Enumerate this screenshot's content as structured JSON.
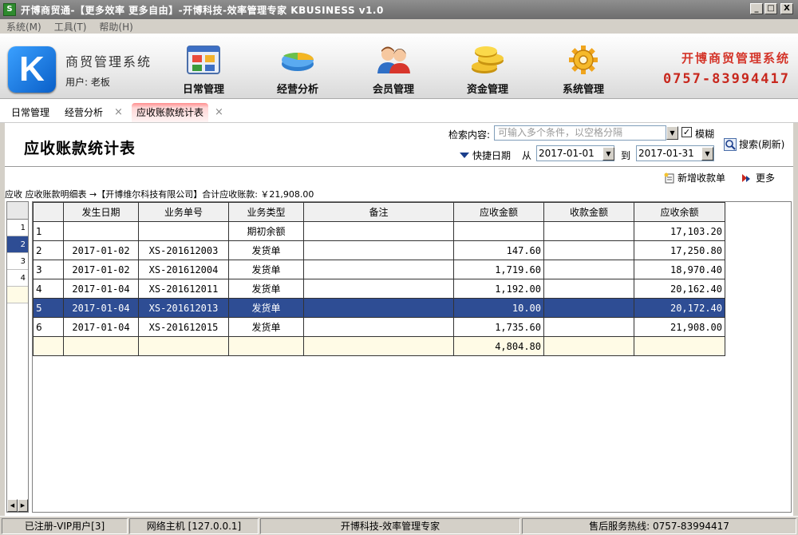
{
  "window": {
    "title": "开博商贸通-【更多效率 更多自由】-开博科技-效率管理专家  KBUSINESS v1.0",
    "icon_letter": "S",
    "btn_min": "_",
    "btn_max": "□",
    "btn_close": "X"
  },
  "menu": [
    "系统(M)",
    "工具(T)",
    "帮助(H)"
  ],
  "header": {
    "logo_letter": "K",
    "system_name": "商贸管理系统",
    "user": "用户: 老板",
    "nav": [
      "日常管理",
      "经营分析",
      "会员管理",
      "资金管理",
      "系统管理"
    ],
    "brand_name": "开博商贸管理系统",
    "brand_phone": "0757-83994417"
  },
  "tabs": {
    "tab1": "日常管理",
    "tab2": "经营分析",
    "tab3": "应收账款统计表",
    "close_glyph": "×"
  },
  "page": {
    "title": "应收账款统计表",
    "search_label": "检索内容:",
    "search_placeholder": "可输入多个条件，以空格分隔",
    "fuzzy_label": "模糊",
    "fuzzy_checked": true,
    "search_button": "搜索(刷新)",
    "quick_date_label": "快捷日期",
    "from_label": "从",
    "date_from": "2017-01-01",
    "to_label": "到",
    "date_to": "2017-01-31",
    "new_receipt": "新增收款单",
    "more": "更多"
  },
  "summary": {
    "lead": "应收",
    "text": "应收账款明细表 →【开博维尔科技有限公司】合计应收账款: ￥21,908.00"
  },
  "mini_grid": {
    "rows": [
      "1",
      "2",
      "3",
      "4"
    ]
  },
  "grid": {
    "columns": [
      "发生日期",
      "业务单号",
      "业务类型",
      "备注",
      "应收金额",
      "收款金额",
      "应收余额"
    ],
    "rows": [
      {
        "no": "1",
        "date": "",
        "doc": "",
        "type": "期初余额",
        "note": "",
        "receivable": "",
        "received": "",
        "balance": "17,103.20"
      },
      {
        "no": "2",
        "date": "2017-01-02",
        "doc": "XS-201612003",
        "type": "发货单",
        "note": "",
        "receivable": "147.60",
        "received": "",
        "balance": "17,250.80"
      },
      {
        "no": "3",
        "date": "2017-01-02",
        "doc": "XS-201612004",
        "type": "发货单",
        "note": "",
        "receivable": "1,719.60",
        "received": "",
        "balance": "18,970.40"
      },
      {
        "no": "4",
        "date": "2017-01-04",
        "doc": "XS-201612011",
        "type": "发货单",
        "note": "",
        "receivable": "1,192.00",
        "received": "",
        "balance": "20,162.40"
      },
      {
        "no": "5",
        "date": "2017-01-04",
        "doc": "XS-201612013",
        "type": "发货单",
        "note": "",
        "receivable": "10.00",
        "received": "",
        "balance": "20,172.40"
      },
      {
        "no": "6",
        "date": "2017-01-04",
        "doc": "XS-201612015",
        "type": "发货单",
        "note": "",
        "receivable": "1,735.60",
        "received": "",
        "balance": "21,908.00"
      }
    ],
    "selected_row": 5,
    "total_receivable": "4,804.80"
  },
  "status": {
    "registered": "已注册-VIP用户[3]",
    "host": "网络主机 [127.0.0.1]",
    "company": "开博科技-效率管理专家",
    "hotline": "售后服务热线: 0757-83994417"
  }
}
